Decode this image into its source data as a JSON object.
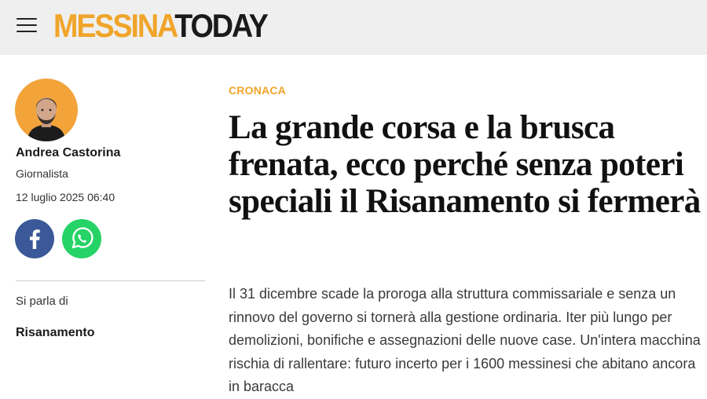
{
  "site": {
    "logo_part1": "MESSINA",
    "logo_part2": "TODAY",
    "brand_color": "#f0a52a"
  },
  "header": {
    "menu_icon": "hamburger-menu-icon"
  },
  "author": {
    "name": "Andrea Castorina",
    "role": "Giornalista",
    "date": "12 luglio 2025 06:40"
  },
  "share": {
    "facebook_icon": "facebook-icon",
    "whatsapp_icon": "whatsapp-icon",
    "facebook_color": "#3b5998",
    "whatsapp_color": "#25d366"
  },
  "tags": {
    "label": "Si parla di",
    "items": [
      "Risanamento"
    ]
  },
  "article": {
    "category": "CRONACA",
    "headline": "La grande corsa e la brusca frenata, ecco perché senza poteri speciali il Risanamento si fermerà",
    "lead": "Il 31 dicembre scade la proroga alla struttura commissariale e senza un rinnovo del governo si tornerà alla gestione ordinaria. Iter più lungo per demolizioni, bonifiche e assegnazioni delle nuove case. Un'intera macchina rischia di rallentare: futuro incerto per i 1600 messinesi che abitano ancora in baracca"
  }
}
